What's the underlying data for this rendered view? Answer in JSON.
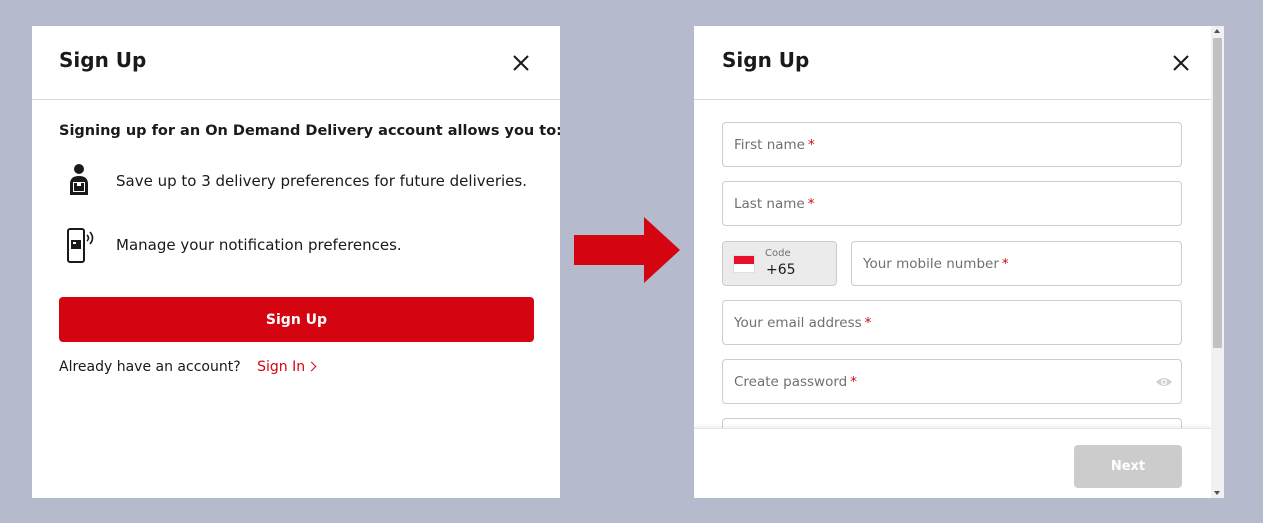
{
  "left_panel": {
    "title": "Sign Up",
    "intro": "Signing up for an On Demand Delivery account allows you to:",
    "features": [
      {
        "icon": "person-package-icon",
        "text": "Save up to 3 delivery preferences for future deliveries."
      },
      {
        "icon": "phone-notification-icon",
        "text": "Manage your notification preferences."
      }
    ],
    "signup_button": "Sign Up",
    "signin_prompt": "Already have an account?",
    "signin_link": "Sign In"
  },
  "right_panel": {
    "title": "Sign Up",
    "fields": {
      "first_name": "First name",
      "last_name": "Last name",
      "code_label": "Code",
      "code_value": "+65",
      "mobile": "Your mobile number",
      "email": "Your email address",
      "password": "Create password"
    },
    "required_mark": "*",
    "next_button": "Next"
  },
  "colors": {
    "brand_red": "#d40511",
    "background": "#b5bacd",
    "disabled_button": "#cccccc"
  },
  "icons": {
    "close": "close-icon",
    "arrow": "right-arrow-icon",
    "flag": "singapore-flag-icon",
    "eye": "eye-icon",
    "chevron": "chevron-right-icon"
  }
}
